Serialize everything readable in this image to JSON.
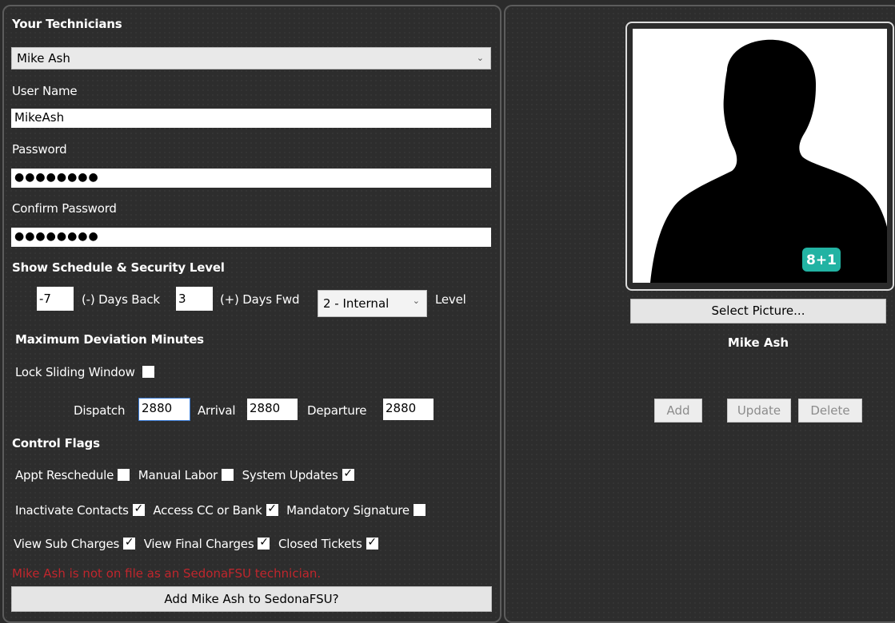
{
  "technicians": {
    "heading": "Your Technicians",
    "selected": "Mike Ash"
  },
  "user_name": {
    "label": "User Name",
    "value": "MikeAsh"
  },
  "password": {
    "label": "Password",
    "masked": "●●●●●●●●"
  },
  "confirm_password": {
    "label": "Confirm Password",
    "masked": "●●●●●●●●"
  },
  "schedule": {
    "heading": "Show Schedule & Security Level",
    "days_back_value": "-7",
    "days_back_label": "(-) Days Back",
    "days_fwd_value": "3",
    "days_fwd_label": "(+) Days Fwd",
    "level_selected": "2 - Internal",
    "level_label": "Level"
  },
  "deviation": {
    "heading": "Maximum Deviation Minutes",
    "lock_label": "Lock Sliding Window",
    "dispatch_label": "Dispatch",
    "dispatch_value": "2880",
    "arrival_label": "Arrival",
    "arrival_value": "2880",
    "departure_label": "Departure",
    "departure_value": "2880"
  },
  "control_flags": {
    "heading": "Control Flags",
    "appt_reschedule": "Appt Reschedule",
    "manual_labor": "Manual Labor",
    "system_updates": "System Updates",
    "inactivate_contacts": "Inactivate Contacts",
    "access_cc_bank": "Access CC or Bank",
    "mandatory_signature": "Mandatory Signature",
    "view_sub_charges": "View Sub Charges",
    "view_final_charges": "View Final Charges",
    "closed_tickets": "Closed Tickets",
    "check_glyph": "✓"
  },
  "status": {
    "error_message": "Mike Ash is not on file as an SedonaFSU technician.",
    "add_button": "Add Mike Ash to SedonaFSU?"
  },
  "profile": {
    "select_picture_button": "Select Picture...",
    "name": "Mike Ash",
    "badge_text": "8+1",
    "add_button": "Add",
    "update_button": "Update",
    "delete_button": "Delete"
  },
  "colors": {
    "background": "#2b2b2b",
    "error": "#c0262d",
    "badge": "#22b3a3"
  },
  "icons": {
    "dropdown": "chevron-down-icon",
    "checkbox_checked": "checkmark-icon",
    "avatar": "person-silhouette-icon"
  }
}
